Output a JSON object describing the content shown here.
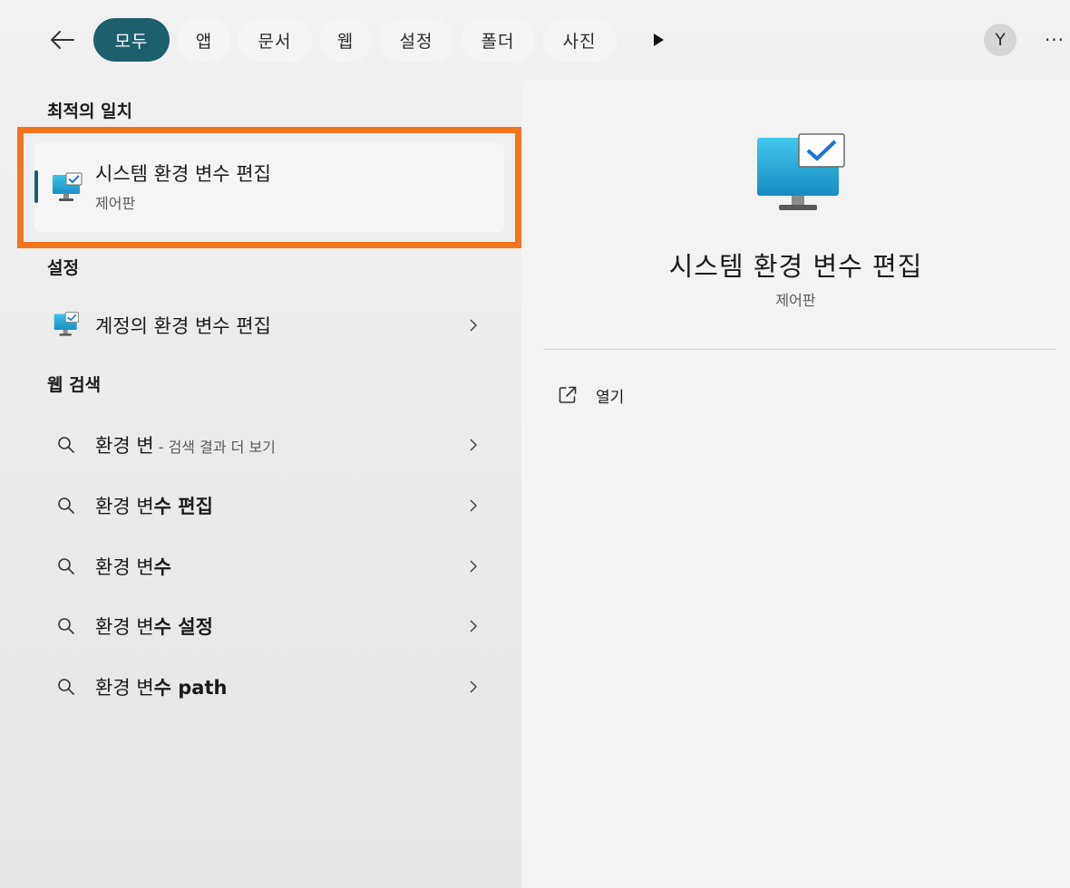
{
  "topbar": {
    "back_icon": "arrow-left-icon",
    "filters": [
      {
        "label": "모두",
        "active": true
      },
      {
        "label": "앱",
        "active": false
      },
      {
        "label": "문서",
        "active": false
      },
      {
        "label": "웹",
        "active": false
      },
      {
        "label": "설정",
        "active": false
      },
      {
        "label": "폴더",
        "active": false
      },
      {
        "label": "사진",
        "active": false
      }
    ],
    "more_filters_icon": "play-triangle-icon",
    "avatar_letter": "Y",
    "overflow_label": "···"
  },
  "best_match": {
    "heading": "최적의 일치",
    "title": "시스템 환경 변수 편집",
    "subtitle": "제어판",
    "icon": "monitor-check-icon"
  },
  "settings": {
    "heading": "설정",
    "items": [
      {
        "label": "계정의 환경 변수 편집",
        "icon": "monitor-check-icon"
      }
    ]
  },
  "web_search": {
    "heading": "웹 검색",
    "items": [
      {
        "plain": "환경 변",
        "bold": "",
        "suffix": " - 검색 결과 더 보기"
      },
      {
        "plain": "환경 변",
        "bold": "수 편집",
        "suffix": ""
      },
      {
        "plain": "환경 변",
        "bold": "수",
        "suffix": ""
      },
      {
        "plain": "환경 변",
        "bold": "수 설정",
        "suffix": ""
      },
      {
        "plain": "환경 변",
        "bold": "수 path",
        "suffix": ""
      }
    ]
  },
  "preview": {
    "title": "시스템 환경 변수 편집",
    "subtitle": "제어판",
    "actions": [
      {
        "label": "열기",
        "icon": "open-external-icon"
      }
    ]
  },
  "colors": {
    "accent": "#1d5f6b",
    "highlight": "#f3741f"
  }
}
